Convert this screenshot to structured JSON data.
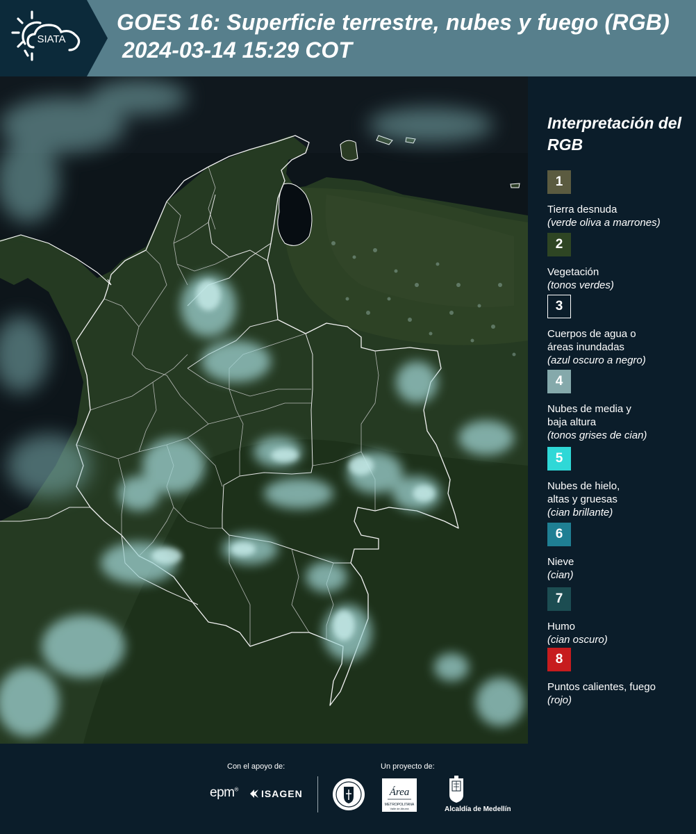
{
  "header": {
    "logo_text": "SIATA",
    "title_line1": "GOES 16: Superficie terrestre, nubes y fuego (RGB)",
    "title_line2": "2024-03-14 15:29 COT"
  },
  "legend": {
    "title": "Interpretación del RGB",
    "items": [
      {
        "number": "1",
        "label": "Tierra desnuda",
        "sub": "(verde oliva a marrones)",
        "color": "#5b5b40"
      },
      {
        "number": "2",
        "label": "Vegetación",
        "sub": "(tonos verdes)",
        "color": "#2e4523"
      },
      {
        "number": "3",
        "label": "Cuerpos de agua o áreas inundadas",
        "sub": "(azul oscuro a negro)",
        "color": "#0b1d2a"
      },
      {
        "number": "4",
        "label": "Nubes de media y baja altura",
        "sub": "(tonos grises de cian)",
        "color": "#85a9ab"
      },
      {
        "number": "5",
        "label": "Nubes de hielo, altas y gruesas",
        "sub": "(cian brillante)",
        "color": "#2fd8d7"
      },
      {
        "number": "6",
        "label": "Nieve",
        "sub": "(cian)",
        "color": "#1f7f93"
      },
      {
        "number": "7",
        "label": "Humo",
        "sub": "(cian oscuro)",
        "color": "#1c4d52"
      },
      {
        "number": "8",
        "label": "Puntos calientes, fuego",
        "sub": "(rojo)",
        "color": "#c71c1e"
      }
    ]
  },
  "footer": {
    "support_caption": "Con el apoyo de:",
    "project_caption": "Un proyecto de:",
    "sponsors": [
      "epm",
      "ISAGEN"
    ],
    "project_partners": [
      "Área Metropolitana",
      "Alcaldía de Medellín"
    ],
    "alcaldia_label": "Alcaldía de Medellín"
  }
}
